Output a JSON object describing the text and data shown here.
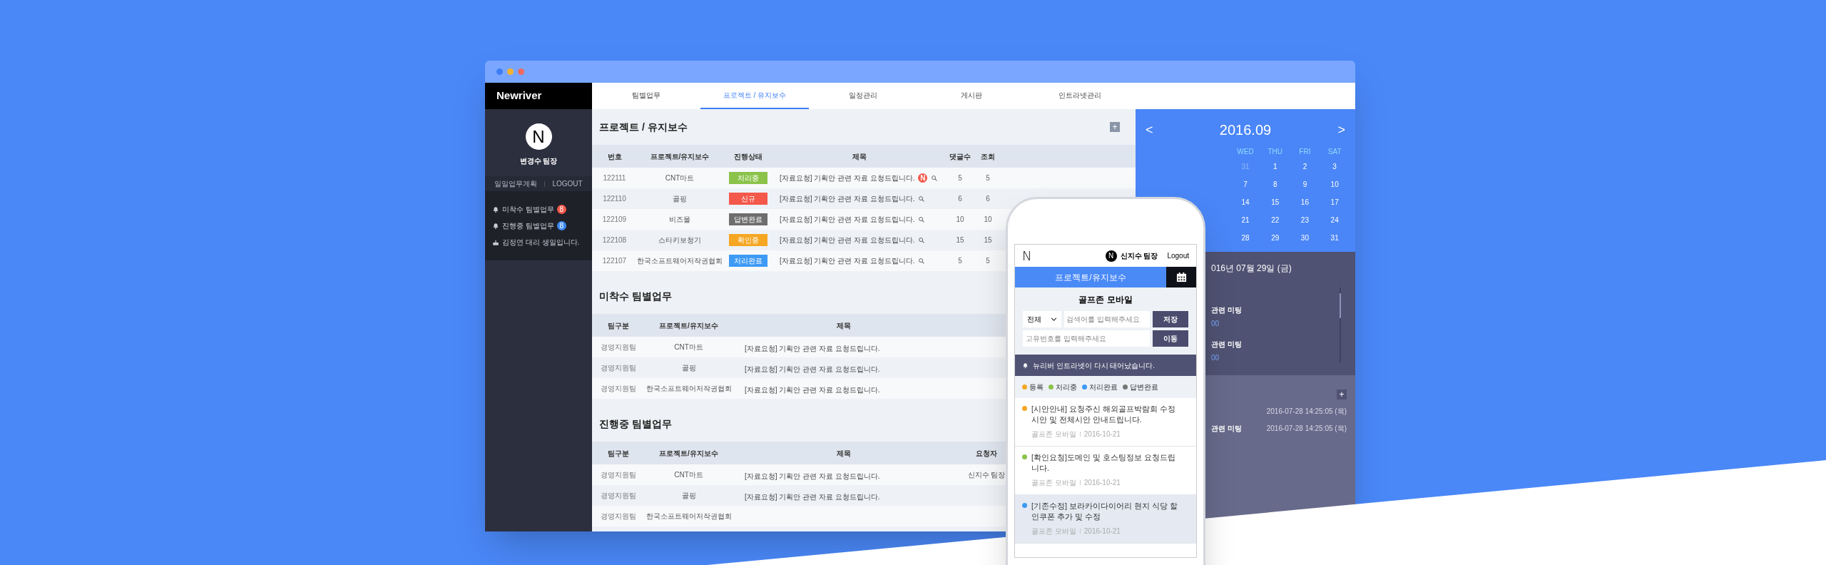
{
  "sidebar": {
    "logo": "Newriver",
    "avatar_letter": "N",
    "user": "변경수 팀장",
    "links": [
      "일일업무계획",
      "LOGOUT"
    ],
    "notices": [
      {
        "kind": "bell",
        "text": "미착수 팀별업무",
        "badge": "8",
        "color": "#f4584a"
      },
      {
        "kind": "bell",
        "text": "진행중 팀별업무",
        "badge": "8",
        "color": "#3d8af7"
      },
      {
        "kind": "cake",
        "text": "김정연 대리 생일입니다."
      }
    ]
  },
  "tabs": [
    {
      "label": "팀별업무",
      "selected": false
    },
    {
      "label": "프로젝트 / 유지보수",
      "selected": true
    },
    {
      "label": "일정관리",
      "selected": false
    },
    {
      "label": "게시판",
      "selected": false
    },
    {
      "label": "인트라넷관리",
      "selected": false
    }
  ],
  "projects": {
    "title": "프로젝트 / 유지보수",
    "add_button": "+",
    "columns": [
      "번호",
      "프로젝트/유지보수",
      "진행상태",
      "제목",
      "댓글수",
      "조회"
    ],
    "rows": [
      {
        "no": "122111",
        "project": "CNT마트",
        "status": "처리중",
        "color": "#8bc34a",
        "title": "[자료요청] 기획안 관련 자료 요청드립니다.",
        "new": true,
        "new_badge": "N",
        "comments": "5",
        "views": "5"
      },
      {
        "no": "122110",
        "project": "골핑",
        "status": "신규",
        "color": "#f4584a",
        "title": "[자료요청] 기획안 관련 자료 요청드립니다.",
        "new": false,
        "comments": "6",
        "views": "6"
      },
      {
        "no": "122109",
        "project": "비즈몰",
        "status": "답변완료",
        "color": "#6e6e6e",
        "title": "[자료요청] 기획안 관련 자료 요청드립니다.",
        "new": false,
        "comments": "10",
        "views": "10"
      },
      {
        "no": "122108",
        "project": "스타키보청기",
        "status": "확인중",
        "color": "#f5a623",
        "title": "[자료요청] 기획안 관련 자료 요청드립니다.",
        "new": false,
        "comments": "15",
        "views": "15"
      },
      {
        "no": "122107",
        "project": "한국소프트웨어저작권협회",
        "status": "처리완료",
        "color": "#3d9af5",
        "title": "[자료요청] 기획안 관련 자료 요청드립니다.",
        "new": false,
        "comments": "5",
        "views": "5"
      }
    ]
  },
  "pending": {
    "title": "미착수 팀별업무",
    "columns": [
      "팀구분",
      "프로젝트/유지보수",
      "제목"
    ],
    "rows": [
      {
        "team": "경영지원팀",
        "project": "CNT마트",
        "title": "[자료요청] 기획안 관련 자료 요청드립니다."
      },
      {
        "team": "경영지원팀",
        "project": "골핑",
        "title": "[자료요청] 기획안 관련 자료 요청드립니다."
      },
      {
        "team": "경영지원팀",
        "project": "한국소프트웨어저작권협회",
        "title": "[자료요청] 기획안 관련 자료 요청드립니다."
      }
    ]
  },
  "in_progress": {
    "title": "진행중 팀별업무",
    "columns": [
      "팀구분",
      "프로젝트/유지보수",
      "제목",
      "요청자"
    ],
    "rows": [
      {
        "team": "경영지원팀",
        "project": "CNT마트",
        "title": "[자료요청] 기획안 관련 자료 요청드립니다.",
        "requester": "신지수 팀장"
      },
      {
        "team": "경영지원팀",
        "project": "골핑",
        "title": "[자료요청] 기획안 관련 자료 요청드립니다."
      },
      {
        "team": "경영지원팀",
        "project": "한국소프트웨어저작권협회"
      }
    ]
  },
  "calendar": {
    "prev": "<",
    "month": "2016.09",
    "next": ">",
    "weekdays": [
      "WED",
      "THU",
      "FRI",
      "SAT"
    ],
    "weeks": [
      [
        {
          "day": "31",
          "muted": true
        },
        {
          "day": "1",
          "muted": false
        },
        {
          "day": "2",
          "muted": false
        },
        {
          "day": "3",
          "muted": false
        }
      ],
      [
        {
          "day": "7",
          "muted": false
        },
        {
          "day": "8",
          "muted": false
        },
        {
          "day": "9",
          "muted": false
        },
        {
          "day": "10",
          "muted": false
        }
      ],
      [
        {
          "day": "14",
          "muted": false
        },
        {
          "day": "15",
          "muted": false
        },
        {
          "day": "16",
          "muted": false
        },
        {
          "day": "17",
          "muted": false
        }
      ],
      [
        {
          "day": "21",
          "muted": false
        },
        {
          "day": "22",
          "muted": false
        },
        {
          "day": "23",
          "muted": false
        },
        {
          "day": "24",
          "muted": false
        }
      ],
      [
        {
          "day": "28",
          "muted": false
        },
        {
          "day": "29",
          "muted": false
        },
        {
          "day": "30",
          "muted": false
        },
        {
          "day": "31",
          "muted": false
        }
      ]
    ],
    "date": "016년 07월 29일 (금)",
    "events": [
      {
        "title": "관련 미팅",
        "time": "00"
      },
      {
        "title": "관련 미팅",
        "time": "00"
      }
    ],
    "add_button": "+",
    "log": [
      {
        "timestamp": "2016-07-28 14:25:05 (목)"
      },
      {
        "title": "관련 미팅",
        "timestamp": "2016-07-28 14:25:05 (목)"
      }
    ]
  },
  "phone": {
    "logo": "N",
    "avatar_letter": "N",
    "user": "신지수 팀장",
    "logout": "Logout",
    "section": "프로젝트/유지보수",
    "heading": "골프존 모바일",
    "select": "전체",
    "search_placeholder": "검색어를 입력해주세요",
    "save_button": "저장",
    "id_placeholder": "고유번호를 입력해주세요",
    "go_button": "이동",
    "notice": "뉴리버 인트라넷이 다시 태어났습니다.",
    "legend": [
      {
        "label": "등록",
        "color": "#f5a623"
      },
      {
        "label": "처리중",
        "color": "#8bc34a"
      },
      {
        "label": "처리완료",
        "color": "#3d9af5"
      },
      {
        "label": "답변완료",
        "color": "#777777"
      }
    ],
    "items": [
      {
        "title": "[시안안내] 요청주신 해외골프박람회 수정시안 및 전체시안 안내드립니다.",
        "color": "#f5a623",
        "source": "골프존 모바일",
        "date": "2016-10-21",
        "selected": false
      },
      {
        "title": "[확인요청]도메인 및 호스팅정보 요청드립니다.",
        "color": "#8bc34a",
        "source": "골프존 모바일",
        "date": "2016-10-21",
        "selected": false
      },
      {
        "title": "[기존수정] 보라카이다이어리 현지 식당 할인쿠폰 추가 및 수정",
        "color": "#3d9af5",
        "source": "골프존 모바일",
        "date": "2016-10-21",
        "selected": true
      }
    ]
  }
}
